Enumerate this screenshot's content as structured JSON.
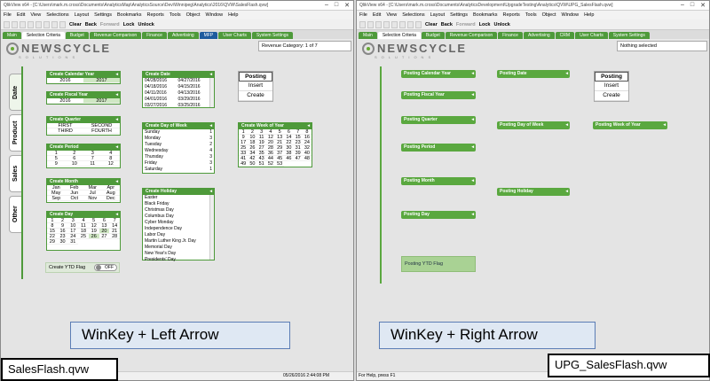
{
  "left": {
    "title": "QlikView x64 - [C:\\Users\\mark.m.cross\\Documents\\AnalyticsMap\\AnalyticsSource\\Dev\\Winnipeg\\Analytics\\2016\\QVW\\SalesFlash.qvw]",
    "menu": [
      "File",
      "Edit",
      "View",
      "Selections",
      "Layout",
      "Settings",
      "Bookmarks",
      "Reports",
      "Tools",
      "Object",
      "Window",
      "Help"
    ],
    "toolbar": {
      "clear": "Clear",
      "back": "Back",
      "forward": "Forward",
      "lock": "Lock",
      "unlock": "Unlock"
    },
    "tabs": [
      "Main",
      "Selection Criteria",
      "Budget",
      "Revenue Comparison",
      "Finance",
      "Advertising",
      "MFP",
      "User Charts",
      "System Settings"
    ],
    "logo": {
      "text": "NEWSCYCLE",
      "sub": "SOLUTIONS"
    },
    "info": "Revenue Category: 1 of 7",
    "side_tabs": [
      "Date",
      "Product",
      "Sales",
      "Other"
    ],
    "listboxes": {
      "calendar_year": {
        "title": "Create Calendar Year",
        "values": [
          "2016",
          "2017"
        ]
      },
      "fiscal_year": {
        "title": "Create Fiscal Year",
        "values": [
          "2016",
          "2017"
        ]
      },
      "quarter": {
        "title": "Create Quarter",
        "values": [
          "FIRST",
          "SECOND",
          "THIRD",
          "FOURTH"
        ]
      },
      "period": {
        "title": "Create Period",
        "values": [
          "1",
          "2",
          "3",
          "4",
          "5",
          "6",
          "7",
          "8",
          "9",
          "10",
          "11",
          "12"
        ]
      },
      "month": {
        "title": "Create Month",
        "values": [
          "Jan",
          "Feb",
          "Mar",
          "Apr",
          "May",
          "Jun",
          "Jul",
          "Aug",
          "Sep",
          "Oct",
          "Nov",
          "Dec"
        ]
      },
      "day": {
        "title": "Create Day",
        "values": [
          "1",
          "2",
          "3",
          "4",
          "5",
          "6",
          "7",
          "8",
          "9",
          "10",
          "11",
          "12",
          "13",
          "14",
          "15",
          "16",
          "17",
          "18",
          "19",
          "20",
          "21",
          "22",
          "23",
          "24",
          "25",
          "26",
          "27",
          "28",
          "29",
          "30",
          "31"
        ]
      },
      "date": {
        "title": "Create Date",
        "values": [
          "04/28/2016",
          "04/27/2016",
          "04/18/2016",
          "04/15/2016",
          "04/11/2016",
          "04/13/2016",
          "04/01/2016",
          "03/29/2016",
          "03/27/2016",
          "03/25/2016"
        ]
      },
      "day_of_week": {
        "title": "Create Day of Week",
        "rows": [
          {
            "name": "Sunday",
            "count": "1"
          },
          {
            "name": "Monday",
            "count": "3"
          },
          {
            "name": "Tuesday",
            "count": "2"
          },
          {
            "name": "Wednesday",
            "count": "4"
          },
          {
            "name": "Thursday",
            "count": "3"
          },
          {
            "name": "Friday",
            "count": "3"
          },
          {
            "name": "Saturday",
            "count": "1"
          }
        ]
      },
      "holiday": {
        "title": "Create Holiday",
        "values": [
          "Easter",
          "Black Friday",
          "Christmas Day",
          "Columbus Day",
          "Cyber Monday",
          "Independence Day",
          "Labor Day",
          "Martin Luther King Jr. Day",
          "Memorial Day",
          "New Year's Day",
          "Presidents' Day"
        ]
      },
      "week_of_year": {
        "title": "Create Week of Year",
        "values": [
          "1",
          "2",
          "3",
          "4",
          "5",
          "6",
          "7",
          "8",
          "9",
          "10",
          "11",
          "12",
          "13",
          "14",
          "15",
          "16",
          "17",
          "18",
          "19",
          "20",
          "21",
          "22",
          "23",
          "24",
          "25",
          "26",
          "27",
          "28",
          "29",
          "30",
          "31",
          "32",
          "33",
          "34",
          "35",
          "36",
          "37",
          "38",
          "39",
          "40",
          "41",
          "42",
          "43",
          "44",
          "45",
          "46",
          "47",
          "48",
          "49",
          "50",
          "51",
          "52",
          "53"
        ]
      }
    },
    "posting_buttons": [
      "Posting",
      "Insert",
      "Create"
    ],
    "ytd": {
      "label": "Create YTD Flag",
      "toggle": "OFF"
    },
    "caption": "WinKey + Left Arrow",
    "filename": "SalesFlash.qvw",
    "status": "05/26/2016 2:44:08 PM"
  },
  "right": {
    "title": "QlikView x64 - [C:\\Users\\mark.m.cross\\Documents\\AnalyticsDevelopment\\UpgradeTesting\\Analytics\\QVW\\UPG_SalesFlash.qvw]",
    "menu": [
      "File",
      "Edit",
      "View",
      "Selections",
      "Layout",
      "Settings",
      "Bookmarks",
      "Reports",
      "Tools",
      "Object",
      "Window",
      "Help"
    ],
    "toolbar": {
      "clear": "Clear",
      "back": "Back",
      "forward": "Forward",
      "lock": "Lock",
      "unlock": "Unlock"
    },
    "tabs": [
      "Main",
      "Selection Criteria",
      "Budget",
      "Revenue Comparison",
      "Finance",
      "Advertising",
      "CRM",
      "User Charts",
      "System Settings"
    ],
    "logo": {
      "text": "NEWSCYCLE",
      "sub": "SOLUTIONS"
    },
    "info": "Nothing selected",
    "listboxes": [
      "Posting Calendar Year",
      "Posting Fiscal Year",
      "Posting Quarter",
      "Posting Period",
      "Posting Month",
      "Posting Day",
      "Posting Date",
      "Posting Day of Week",
      "Posting Holiday",
      "Posting Week of Year"
    ],
    "posting_buttons": [
      "Posting",
      "Insert",
      "Create"
    ],
    "ytd": "Posting YTD Flag",
    "caption": "WinKey + Right Arrow",
    "filename": "UPG_SalesFlash.qvw",
    "status": "For Help, press F1"
  }
}
